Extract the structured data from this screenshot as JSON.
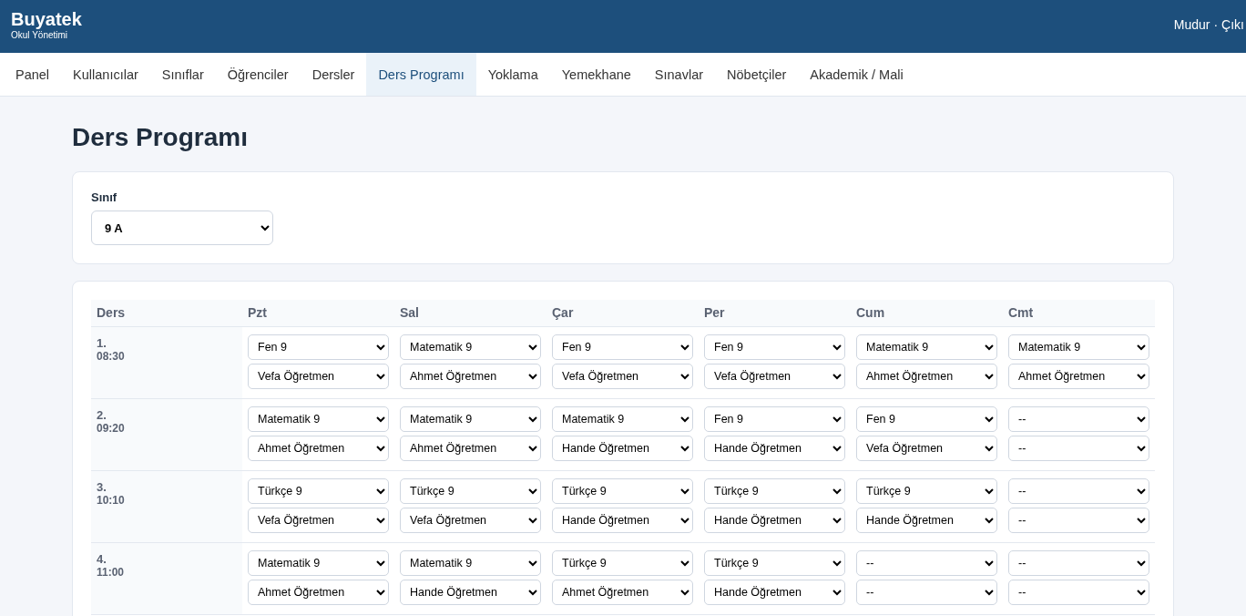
{
  "brand": {
    "name": "Buyatek",
    "subtitle": "Okul Yönetimi"
  },
  "user": {
    "name": "Mudur",
    "separator": "·",
    "logout": "Çıkı"
  },
  "nav": [
    {
      "label": "Panel",
      "selected": false
    },
    {
      "label": "Kullanıcılar",
      "selected": false
    },
    {
      "label": "Sınıflar",
      "selected": false
    },
    {
      "label": "Öğrenciler",
      "selected": false
    },
    {
      "label": "Dersler",
      "selected": false
    },
    {
      "label": "Ders Programı",
      "selected": true
    },
    {
      "label": "Yoklama",
      "selected": false
    },
    {
      "label": "Yemekhane",
      "selected": false
    },
    {
      "label": "Sınavlar",
      "selected": false
    },
    {
      "label": "Nöbetçiler",
      "selected": false
    },
    {
      "label": "Akademik / Mali",
      "selected": false
    }
  ],
  "page_title": "Ders Programı",
  "class_filter": {
    "label": "Sınıf",
    "value": "9 A"
  },
  "schedule": {
    "lesson_header": "Ders",
    "days": [
      "Pzt",
      "Sal",
      "Çar",
      "Per",
      "Cum",
      "Cmt"
    ],
    "rows": [
      {
        "number": "1.",
        "time": "08:30",
        "cells": [
          {
            "lesson": "Fen 9",
            "teacher": "Vefa Öğretmen"
          },
          {
            "lesson": "Matematik 9",
            "teacher": "Ahmet Öğretmen"
          },
          {
            "lesson": "Fen 9",
            "teacher": "Vefa Öğretmen"
          },
          {
            "lesson": "Fen 9",
            "teacher": "Vefa Öğretmen"
          },
          {
            "lesson": "Matematik 9",
            "teacher": "Ahmet Öğretmen"
          },
          {
            "lesson": "Matematik 9",
            "teacher": "Ahmet Öğretmen"
          }
        ]
      },
      {
        "number": "2.",
        "time": "09:20",
        "cells": [
          {
            "lesson": "Matematik 9",
            "teacher": "Ahmet Öğretmen"
          },
          {
            "lesson": "Matematik 9",
            "teacher": "Ahmet Öğretmen"
          },
          {
            "lesson": "Matematik 9",
            "teacher": "Hande Öğretmen"
          },
          {
            "lesson": "Fen 9",
            "teacher": "Hande Öğretmen"
          },
          {
            "lesson": "Fen 9",
            "teacher": "Vefa Öğretmen"
          },
          {
            "lesson": "--",
            "teacher": "--"
          }
        ]
      },
      {
        "number": "3.",
        "time": "10:10",
        "cells": [
          {
            "lesson": "Türkçe 9",
            "teacher": "Vefa Öğretmen"
          },
          {
            "lesson": "Türkçe 9",
            "teacher": "Vefa Öğretmen"
          },
          {
            "lesson": "Türkçe 9",
            "teacher": "Hande Öğretmen"
          },
          {
            "lesson": "Türkçe 9",
            "teacher": "Hande Öğretmen"
          },
          {
            "lesson": "Türkçe 9",
            "teacher": "Hande Öğretmen"
          },
          {
            "lesson": "--",
            "teacher": "--"
          }
        ]
      },
      {
        "number": "4.",
        "time": "11:00",
        "cells": [
          {
            "lesson": "Matematik 9",
            "teacher": "Ahmet Öğretmen"
          },
          {
            "lesson": "Matematik 9",
            "teacher": "Hande Öğretmen"
          },
          {
            "lesson": "Türkçe 9",
            "teacher": "Ahmet Öğretmen"
          },
          {
            "lesson": "Türkçe 9",
            "teacher": "Hande Öğretmen"
          },
          {
            "lesson": "--",
            "teacher": "--"
          },
          {
            "lesson": "--",
            "teacher": "--"
          }
        ]
      }
    ]
  }
}
